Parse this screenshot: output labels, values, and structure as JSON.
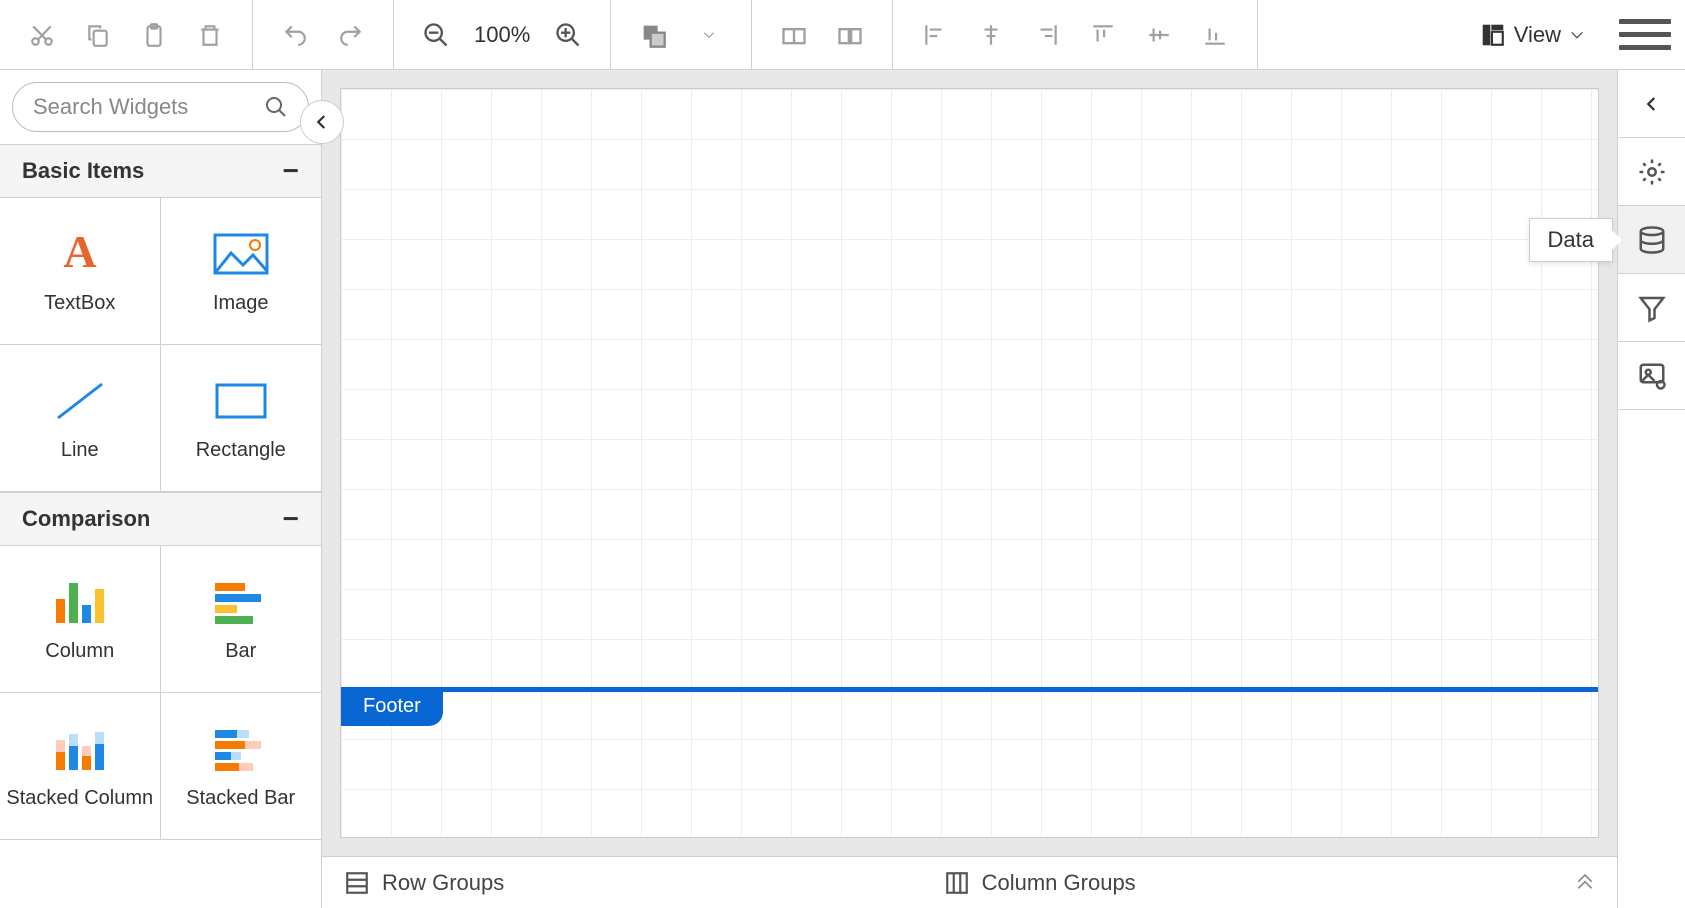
{
  "toolbar": {
    "zoom": "100%",
    "view_label": "View"
  },
  "sidebar": {
    "search_placeholder": "Search Widgets",
    "sections": [
      {
        "title": "Basic Items",
        "items": [
          {
            "label": "TextBox",
            "icon": "textbox"
          },
          {
            "label": "Image",
            "icon": "image"
          },
          {
            "label": "Line",
            "icon": "line"
          },
          {
            "label": "Rectangle",
            "icon": "rectangle"
          }
        ]
      },
      {
        "title": "Comparison",
        "items": [
          {
            "label": "Column",
            "icon": "column-chart"
          },
          {
            "label": "Bar",
            "icon": "bar-chart"
          },
          {
            "label": "Stacked Column",
            "icon": "stacked-column"
          },
          {
            "label": "Stacked Bar",
            "icon": "stacked-bar"
          }
        ]
      }
    ]
  },
  "canvas": {
    "footer_label": "Footer"
  },
  "bottom": {
    "row_groups": "Row Groups",
    "column_groups": "Column Groups"
  },
  "right_panel": {
    "tooltip": "Data"
  }
}
